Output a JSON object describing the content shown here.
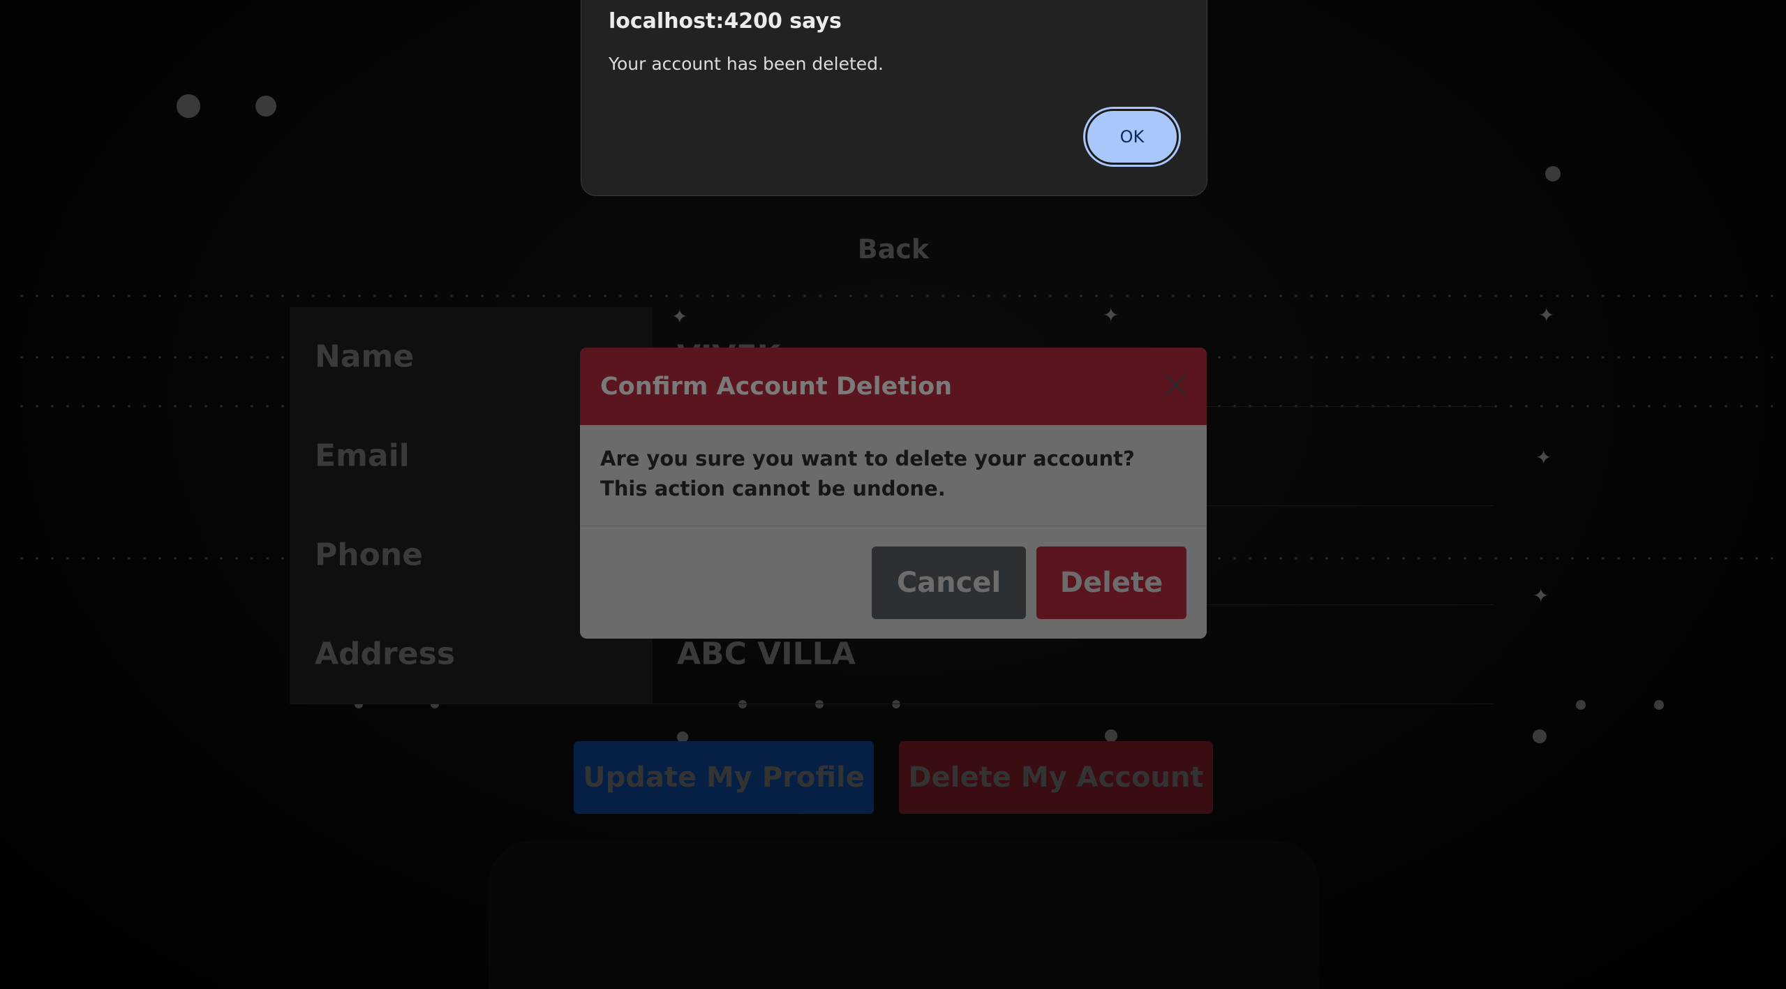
{
  "alert": {
    "title": "localhost:4200 says",
    "message": "Your account has been deleted.",
    "ok_label": "OK"
  },
  "page": {
    "back_label": "Back",
    "profile_rows": [
      {
        "label": "Name",
        "value": "VIVEK"
      },
      {
        "label": "Email",
        "value": ""
      },
      {
        "label": "Phone",
        "value": ""
      },
      {
        "label": "Address",
        "value": "ABC VILLA"
      }
    ],
    "update_button": "Update My Profile",
    "delete_account_button": "Delete My Account"
  },
  "modal": {
    "title": "Confirm Account Deletion",
    "body": "Are you sure you want to delete your account? This action cannot be undone.",
    "cancel_label": "Cancel",
    "delete_label": "Delete"
  },
  "colors": {
    "modal_header": "#5a151e",
    "cancel_button": "#2d3033",
    "ok_button": "#a9c7fa",
    "update_button": "#051f45",
    "delete_button": "#3a0d12"
  },
  "icons": {
    "modal_close": "close-icon"
  }
}
